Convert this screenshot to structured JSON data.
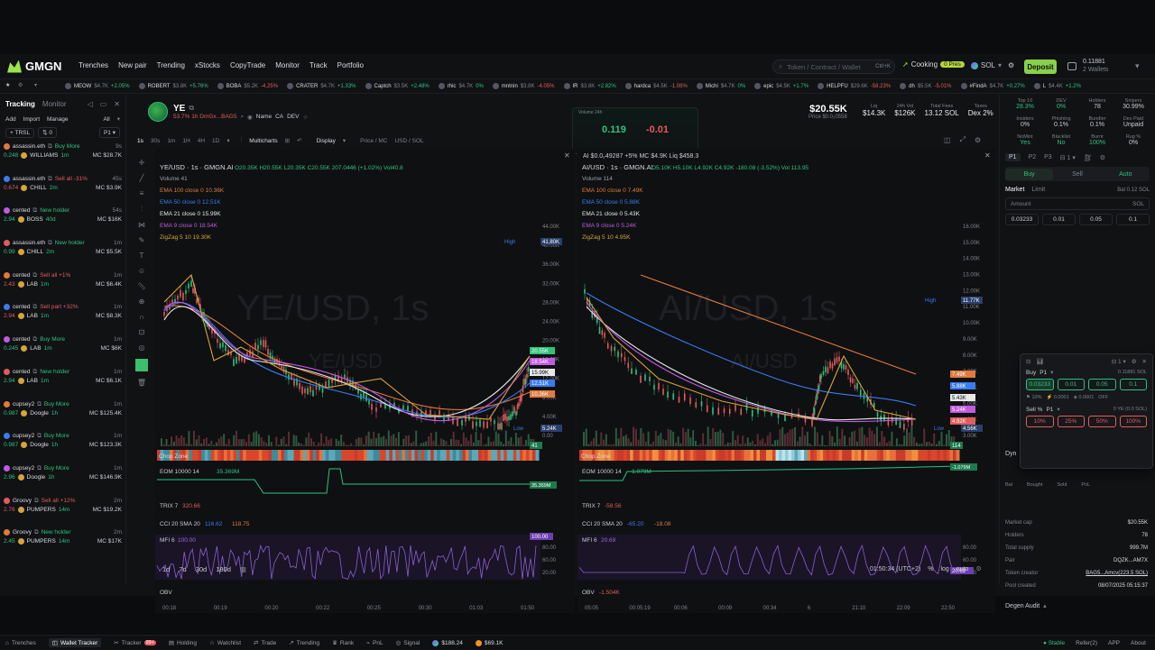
{
  "brand": {
    "name": "GMGN",
    "logo_color": "#9de34a"
  },
  "nav": [
    "Trenches",
    "New pair",
    "Trending",
    "xStocks",
    "CopyTrade",
    "Monitor",
    "Track",
    "Portfolio"
  ],
  "search": {
    "placeholder": "Token / Contract / Wallet",
    "hint": "Ctrl+K"
  },
  "cooking": {
    "label": "Cooking",
    "badge": "0 Pres"
  },
  "chain": "SOL",
  "deposit_label": "Deposit",
  "wallet": {
    "balance": "0.11881",
    "sub": "2 Wallets"
  },
  "ticker": [
    {
      "name": "MEOW",
      "mc": "$4.7K",
      "chg": "+2.05%"
    },
    {
      "name": "ROBERT",
      "mc": "$3.8K",
      "chg": "+5.76%"
    },
    {
      "name": "BOBA",
      "mc": "$5.2K",
      "chg": "-4.25%"
    },
    {
      "name": "CRATER",
      "mc": "$4.7K",
      "chg": "+1.33%"
    },
    {
      "name": "Captch",
      "mc": "$3.5K",
      "chg": "+2.48%"
    },
    {
      "name": "rhic",
      "mc": "$4.7K",
      "chg": "0%"
    },
    {
      "name": "mntnin",
      "mc": "$3.8K",
      "chg": "-4.05%"
    },
    {
      "name": "IR",
      "mc": "$3.8K",
      "chg": "+2.82%"
    },
    {
      "name": "hardca",
      "mc": "$4.5K",
      "chg": "-1.08%"
    },
    {
      "name": "Michi",
      "mc": "$4.7K",
      "chg": "0%"
    },
    {
      "name": "epic",
      "mc": "$4.5K",
      "chg": "+1.7%"
    },
    {
      "name": "HELPFU",
      "mc": "$29.6K",
      "chg": "-58.23%"
    },
    {
      "name": "dh",
      "mc": "$5.5K",
      "chg": "-5.01%"
    },
    {
      "name": "#FindA",
      "mc": "$4.7K",
      "chg": "+0.27%"
    },
    {
      "name": "L",
      "mc": "$4.4K",
      "chg": "+1.2%"
    }
  ],
  "tracking": {
    "tabs": [
      "Tracking",
      "Monitor"
    ],
    "actions": [
      "Add",
      "Import",
      "Manage",
      "All"
    ],
    "filter": "TRSL",
    "entries": [
      {
        "user": "assassin.eth",
        "action": "Buy More",
        "time": "9s",
        "amount": "0.248",
        "token": "WILLIAMS",
        "age": "1m",
        "mc": "MC $28.7K",
        "action_color": "#2ec27e"
      },
      {
        "user": "assassin.eth",
        "action": "Sell all -31%",
        "time": "45s",
        "amount": "0.674",
        "token": "CHILL",
        "age": "2m",
        "mc": "MC $3.9K",
        "action_color": "#e25c5c"
      },
      {
        "user": "cented",
        "action": "New holder",
        "time": "54s",
        "amount": "2.94",
        "token": "BOSS",
        "age": "40d",
        "mc": "MC $16K",
        "action_color": "#2ec27e"
      },
      {
        "user": "assassin.eth",
        "action": "New holder",
        "time": "1m",
        "amount": "0.99",
        "token": "CHILL",
        "age": "2m",
        "mc": "MC $5.5K",
        "action_color": "#2ec27e"
      },
      {
        "user": "cented",
        "action": "Sell all +1%",
        "time": "1m",
        "amount": "2.43",
        "token": "LAB",
        "age": "1m",
        "mc": "MC $6.4K",
        "action_color": "#e25c5c"
      },
      {
        "user": "cented",
        "action": "Sell part +32%",
        "time": "1m",
        "amount": "2.94",
        "token": "LAB",
        "age": "1m",
        "mc": "MC $8.3K",
        "action_color": "#e25c5c"
      },
      {
        "user": "cented",
        "action": "Buy More",
        "time": "1m",
        "amount": "0.245",
        "token": "LAB",
        "age": "1m",
        "mc": "MC $6K",
        "action_color": "#2ec27e"
      },
      {
        "user": "cented",
        "action": "New holder",
        "time": "1m",
        "amount": "2.94",
        "token": "LAB",
        "age": "1m",
        "mc": "MC $6.1K",
        "action_color": "#2ec27e"
      },
      {
        "user": "cupsey2",
        "action": "Buy More",
        "time": "1m",
        "amount": "0.987",
        "token": "Doogle",
        "age": "1h",
        "mc": "MC $125.4K",
        "action_color": "#2ec27e"
      },
      {
        "user": "cupsey2",
        "action": "Buy More",
        "time": "1m",
        "amount": "0.987",
        "token": "Doogle",
        "age": "1h",
        "mc": "MC $123.3K",
        "action_color": "#2ec27e"
      },
      {
        "user": "cupsey2",
        "action": "Buy More",
        "time": "1m",
        "amount": "2.96",
        "token": "Doogle",
        "age": "1h",
        "mc": "MC $146.9K",
        "action_color": "#2ec27e"
      },
      {
        "user": "Groovy",
        "action": "Sell all +12%",
        "time": "2m",
        "amount": "2.76",
        "token": "PUMPERS",
        "age": "14m",
        "mc": "MC $19.2K",
        "action_color": "#e25c5c"
      },
      {
        "user": "Groovy",
        "action": "New holder",
        "time": "2m",
        "amount": "2.45",
        "token": "PUMPERS",
        "age": "14m",
        "mc": "MC $17K",
        "action_color": "#2ec27e"
      }
    ]
  },
  "token": {
    "symbol": "YE",
    "price_line": "53.7% 1h DmGx...BAG5",
    "price": "$20.55K",
    "price_sub": "Price $0.0₂0558",
    "stats": [
      {
        "label": "Liq",
        "value": "$14.3K"
      },
      {
        "label": "24h Vol",
        "value": "$126K"
      },
      {
        "label": "Total Fees",
        "value": "13.12 SOL"
      },
      {
        "label": "Taxes",
        "value": "Dex 2%"
      }
    ],
    "links": [
      "Name",
      "CA",
      "DEV"
    ]
  },
  "toolbar": {
    "timeframes": [
      "1s",
      "30s",
      "1m",
      "1H",
      "4H",
      "1D"
    ],
    "multicharts": "Multicharts",
    "display": "Display",
    "mode": "Price / MC",
    "currency": "USD / SOL"
  },
  "overlay_box": {
    "label": "Volume 24h",
    "green": "0.119",
    "red": "-0.01"
  },
  "chart_left": {
    "title": "YE/USD · 1s · GMGN.AI",
    "ohlc": "O20.35K H20.55K L20.35K C20.55K 207.0446 (+1.02%) Vol40.8",
    "watermark": "YE/USD, 1s",
    "watermark2": "YE/USD",
    "volume": "Volume 41",
    "ema_lines": [
      "EMA 100 close 0 10.36K",
      "EMA 50 close 0 12.51K",
      "EMA 21 close 0 15.99K",
      "EMA 9 close 0 18.54K",
      "ZigZag 5 10 19.30K"
    ],
    "axis": [
      "44.00K",
      "40.00K",
      "36.00K",
      "32.00K",
      "28.00K",
      "24.00K",
      "20.00K",
      "16.00K",
      "12.00K",
      "8.00K",
      "4.00K",
      "0.00"
    ],
    "high": "High",
    "high_val": "41.80K",
    "low": "Low",
    "low_val": "5.24K",
    "price_tags": [
      {
        "text": "20.55K",
        "color": "#2ec27e"
      },
      {
        "text": "18.54K",
        "color": "#c05be0"
      },
      {
        "text": "15.99K",
        "color": "#e8e8e8"
      },
      {
        "text": "12.51K",
        "color": "#3a7bf0"
      },
      {
        "text": "10.36K",
        "color": "#e07a3d"
      }
    ],
    "vol_tag": "41",
    "chop_label": "Chop Zone",
    "eom_label": "EOM 10000 14",
    "eom_val": "35.369M",
    "eom_tag": "35.369M",
    "trix_label": "TRIX 7",
    "trix_val": "320.66",
    "cci_label": "CCI 20 SMA 20",
    "cci_val": "116.62",
    "cci_val2": "118.75",
    "mfi_label": "MFI 6",
    "mfi_val": "100.00",
    "mfi_tag": "100.00",
    "mfi_axis": [
      "80.00",
      "60.00",
      "20.00"
    ],
    "obv_label": "OBV",
    "time_axis": [
      "00:18",
      "00:19",
      "00:20",
      "00:22",
      "00:25",
      "00:30",
      "01:03",
      "01:50"
    ]
  },
  "chart_right": {
    "title": "AI/USD · 1s · GMGN.AI",
    "ohlc": "O5.10K H5.10K L4.92K C4.92K -180.08 (-3.52%) Vol 113.95",
    "prefix": "AI $0.0₂49287 +5% MC $4.9K Liq $458.3",
    "watermark": "AI/USD, 1s",
    "watermark2": "AI/USD",
    "volume": "Volume 114",
    "ema_lines": [
      "EMA 100 close 0 7.49K",
      "EMA 50 close 0 5.88K",
      "EMA 21 close 0 5.43K",
      "EMA 9 close 0 5.24K",
      "ZigZag 5 10 4.95K"
    ],
    "axis": [
      "16.00K",
      "15.00K",
      "14.00K",
      "13.00K",
      "12.00K",
      "11.00K",
      "10.00K",
      "9.00K",
      "8.00K",
      "7.00K",
      "6.00K",
      "5.00K",
      "4.00K",
      "3.00K"
    ],
    "high": "High",
    "high_val": "11.77K",
    "low": "Low",
    "low_val": "4.56K",
    "price_tags": [
      {
        "text": "7.49K",
        "color": "#e07a3d"
      },
      {
        "text": "5.88K",
        "color": "#3a7bf0"
      },
      {
        "text": "5.43K",
        "color": "#e8e8e8"
      },
      {
        "text": "5.24K",
        "color": "#c05be0"
      },
      {
        "text": "4.92K",
        "color": "#e25c5c"
      }
    ],
    "vol_tag": "114",
    "chop_label": "Chop Zone",
    "eom_label": "EOM 10000 14",
    "eom_val": "-1.079M",
    "eom_tag": "-1.079M",
    "trix_label": "TRIX 7",
    "trix_val": "-58.56",
    "cci_label": "CCI 20 SMA 20",
    "cci_val": "-65.20",
    "cci_val2": "-18.08",
    "mfi_label": "MFI 6",
    "mfi_val": "20.69",
    "mfi_tag": "20.69",
    "mfi_axis": [
      "80.00",
      "60.00",
      "40.00"
    ],
    "obv_label": "OBV",
    "obv_val": "-1.504K",
    "time_axis": [
      "05:05",
      "00:05:19",
      "00:06",
      "00:09",
      "00:34",
      "6",
      "21:10",
      "22:09",
      "22:50"
    ]
  },
  "range_buttons": [
    "1d",
    "7d",
    "30d",
    "180d"
  ],
  "clock": "01:50:34 (UTC+2)",
  "scale_opts": [
    "%",
    "log",
    "auto"
  ],
  "right_panel": {
    "stats": [
      {
        "label": "Top 10",
        "value": "28.3%",
        "color": "#2ec27e"
      },
      {
        "label": "DEV",
        "value": "0%",
        "color": "#2ec27e"
      },
      {
        "label": "Holders",
        "value": "78",
        "color": "#c9ccd2"
      },
      {
        "label": "Snipers",
        "value": "30.99%",
        "color": "#c9ccd2"
      },
      {
        "label": "Insiders",
        "value": "0%",
        "color": "#c9ccd2"
      },
      {
        "label": "Phishing",
        "value": "0.1%",
        "color": "#c9ccd2"
      },
      {
        "label": "Bundler",
        "value": "0.1%",
        "color": "#c9ccd2"
      },
      {
        "label": "Dex Paid",
        "value": "Unpaid",
        "color": "#c9ccd2"
      },
      {
        "label": "NoMint",
        "value": "Yes",
        "color": "#2ec27e"
      },
      {
        "label": "Blacklist",
        "value": "No",
        "color": "#2ec27e"
      },
      {
        "label": "Burnt",
        "value": "100%",
        "color": "#2ec27e"
      },
      {
        "label": "Rug %",
        "value": "0%",
        "color": "#c9ccd2"
      }
    ],
    "presets": [
      "P1",
      "P2",
      "P3"
    ],
    "buy_label": "Buy",
    "sell_label": "Sell",
    "auto_label": "Auto",
    "market_label": "Market",
    "limit_label": "Limit",
    "balance": "Bal 0.12 SOL",
    "amount_label": "Amount",
    "amount_unit": "SOL",
    "quick_amounts": [
      "0.03233",
      "0.01",
      "0.05",
      "0.1"
    ],
    "popup_buy": "Buy",
    "popup_p1": "P1",
    "popup_amounts": [
      "0.03233",
      "0.01",
      "0.05",
      "0.1"
    ],
    "popup_sell": "Sell %",
    "popup_sell_p": "P1",
    "popup_pcts": [
      "10%",
      "25%",
      "50%",
      "100%"
    ],
    "popup_bal": "0 YE (0.0 SOL)",
    "popup_bal2": "0.11881 SOL",
    "popup_count": "1",
    "details": [
      {
        "label": "Market cap",
        "value": "$20.55K"
      },
      {
        "label": "Holders",
        "value": "78"
      },
      {
        "label": "Total supply",
        "value": "999.7M"
      },
      {
        "label": "Pair",
        "value": "DQZK...AM7X"
      },
      {
        "label": "Token creator",
        "value": "BAG5...Amcv(223.5 SOL)"
      },
      {
        "label": "Pool created",
        "value": "08/07/2025 05:15:37"
      }
    ],
    "degen_audit": "Degen Audit",
    "dyn_label": "Dyn",
    "bought_label": "Bought",
    "sold_label": "Sold",
    "bal_label": "Bal",
    "pnl_label": "PnL"
  },
  "bottom": {
    "items": [
      "Trenches",
      "Wallet Tracker",
      "Tracker",
      "Holding",
      "Watchlist",
      "Trade",
      "Trending",
      "Rank",
      "PnL",
      "Signal"
    ],
    "tracker_badge": "99+",
    "sol_price": "$188.24",
    "btc_price": "$69.1K",
    "stable": "Stable",
    "refer": "Refer(2)",
    "app": "APP",
    "about": "About"
  }
}
